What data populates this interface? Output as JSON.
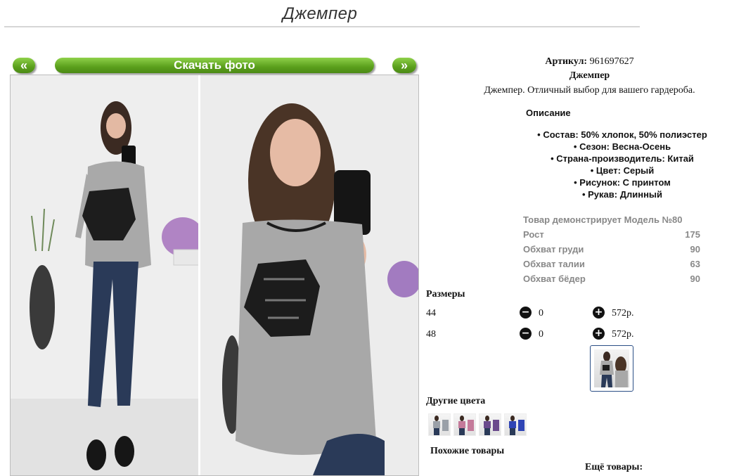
{
  "page": {
    "title": "Джемпер"
  },
  "gallery": {
    "prev_label": "«",
    "next_label": "»",
    "download_label": "Скачать фото"
  },
  "product": {
    "sku_label": "Артикул:",
    "sku": "961697627",
    "name": "Джемпер",
    "short_description": "Джемпер. Отличный выбор для вашего гардероба.",
    "description_heading": "Описание",
    "features": [
      "Состав: 50% хлопок, 50% полиэстер",
      "Сезон: Весна-Осень",
      "Страна-производитель: Китай",
      "Цвет: Серый",
      "Рисунок: С принтом",
      "Рукав: Длинный"
    ]
  },
  "model": {
    "heading": "Товар демонстрирует Модель №80",
    "rows": [
      {
        "label": "Рост",
        "value": "175"
      },
      {
        "label": "Обхват груди",
        "value": "90"
      },
      {
        "label": "Обхват талии",
        "value": "63"
      },
      {
        "label": "Обхват бёдер",
        "value": "90"
      }
    ]
  },
  "sizes": {
    "heading": "Размеры",
    "minus_icon": "minus-circle-icon",
    "plus_icon": "plus-circle-icon",
    "items": [
      {
        "size": "44",
        "qty": "0",
        "price": "572р."
      },
      {
        "size": "48",
        "qty": "0",
        "price": "572р."
      }
    ]
  },
  "other_colors": {
    "heading": "Другие цвета",
    "swatches": [
      "#9aa0a8",
      "#c47a9a",
      "#6a4a8c",
      "#2f45b5"
    ]
  },
  "similar": {
    "heading": "Похожие товары"
  },
  "more": {
    "heading": "Ещё товары:"
  },
  "colors": {
    "accent_green": "#5a9f1c",
    "thumb_border": "#2b4f86",
    "model_text": "#888888"
  }
}
